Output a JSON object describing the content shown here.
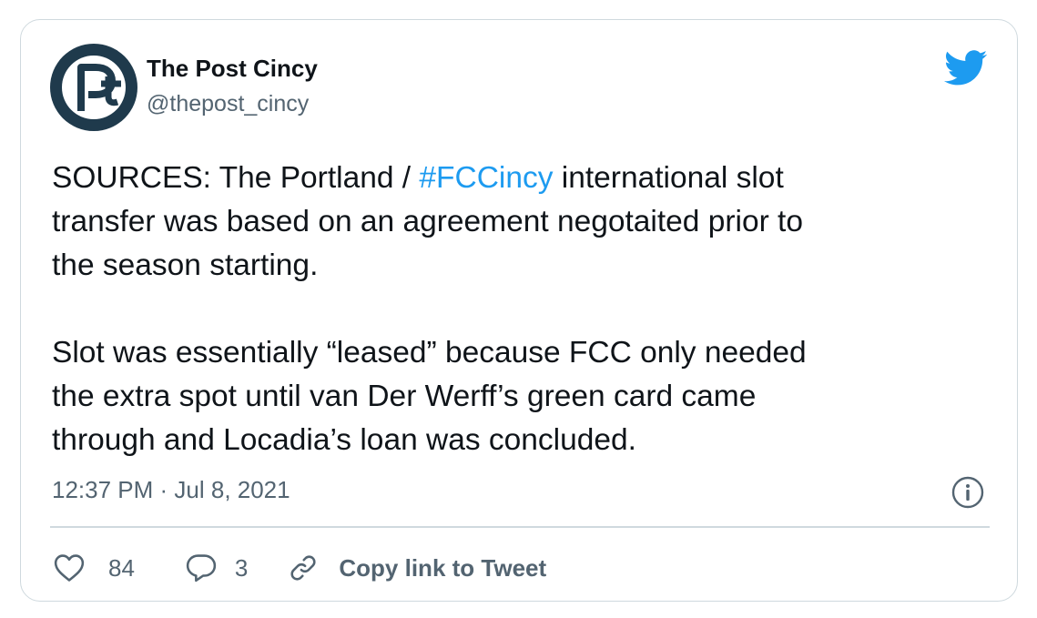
{
  "author": {
    "name": "The Post Cincy",
    "handle": "@thepost_cincy",
    "avatar_color": "#1f3a4c",
    "avatar_icon": "the-post-logo-icon"
  },
  "tweet": {
    "text_part1": "SOURCES: The Portland / ",
    "hashtag": "#FCCincy",
    "text_part2": " international slot",
    "line2": "transfer was based on an agreement negotaited prior to",
    "line3": "the season starting.",
    "line4": "Slot was essentially “leased” because FCC only needed",
    "line5": "the extra spot until van Der Werff’s green card came",
    "line6": "through and Locadia’s loan was concluded."
  },
  "meta": {
    "timestamp": "12:37 PM · Jul 8, 2021",
    "info_icon": "info-icon"
  },
  "actions": {
    "likes": "84",
    "replies": "3",
    "copy_link_label": "Copy link to Tweet",
    "like_icon": "heart-icon",
    "reply_icon": "reply-icon",
    "link_icon": "link-icon"
  },
  "brand": {
    "logo_icon": "twitter-bird-icon",
    "accent": "#1d9bf0",
    "text_secondary": "#536471",
    "border": "#cfd9de"
  }
}
